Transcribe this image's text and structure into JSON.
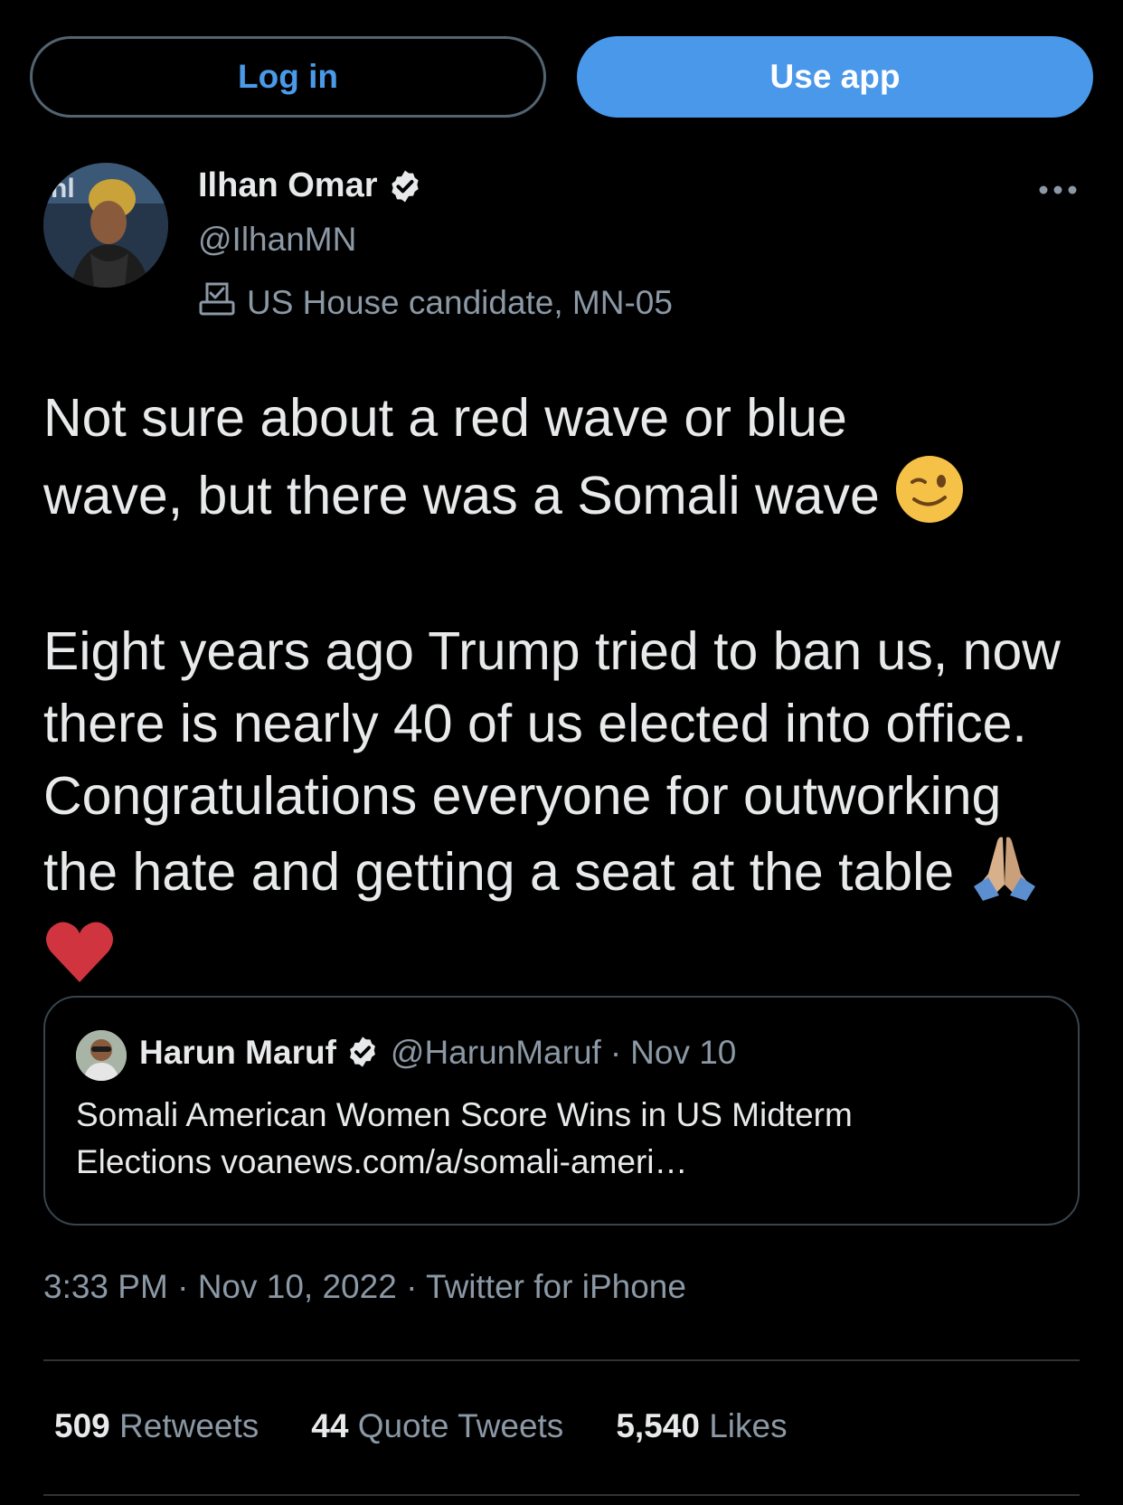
{
  "top_bar": {
    "login_label": "Log in",
    "use_app_label": "Use app"
  },
  "author": {
    "name": "Ilhan Omar",
    "handle": "@IlhanMN",
    "label": "US House candidate, MN-05"
  },
  "tweet": {
    "line1a": "Not sure about a red wave or blue",
    "line1b": "wave, but there was a Somali wave",
    "paragraph2": "Eight years ago Trump tried to ban us, now there is nearly 40 of us elected into office. Congratulations everyone for outworking the hate and getting a seat at the table"
  },
  "quote": {
    "name": "Harun Maruf",
    "handle": "@HarunMaruf",
    "separator": "·",
    "date": "Nov 10",
    "text_line1": "Somali American Women Score Wins in US Midterm",
    "text_line2": "Elections",
    "link": "voanews.com/a/somali-ameri…"
  },
  "meta": {
    "time": "3:33 PM",
    "sep1": "·",
    "date": "Nov 10, 2022",
    "sep2": "·",
    "source": "Twitter for iPhone"
  },
  "stats": {
    "retweets_count": "509",
    "retweets_label": "Retweets",
    "quotes_count": "44",
    "quotes_label": "Quote Tweets",
    "likes_count": "5,540",
    "likes_label": "Likes"
  },
  "colors": {
    "background": "#000000",
    "accent": "#4a98ea",
    "text_primary": "#e7e9ea",
    "text_secondary": "#8b98a5",
    "border": "#38444d"
  },
  "icons": {
    "verified": "verified-badge-icon",
    "more": "more-icon",
    "label": "ballot-box-icon",
    "wink": "winking-face-icon",
    "pray": "folded-hands-icon",
    "heart": "red-heart-icon"
  }
}
